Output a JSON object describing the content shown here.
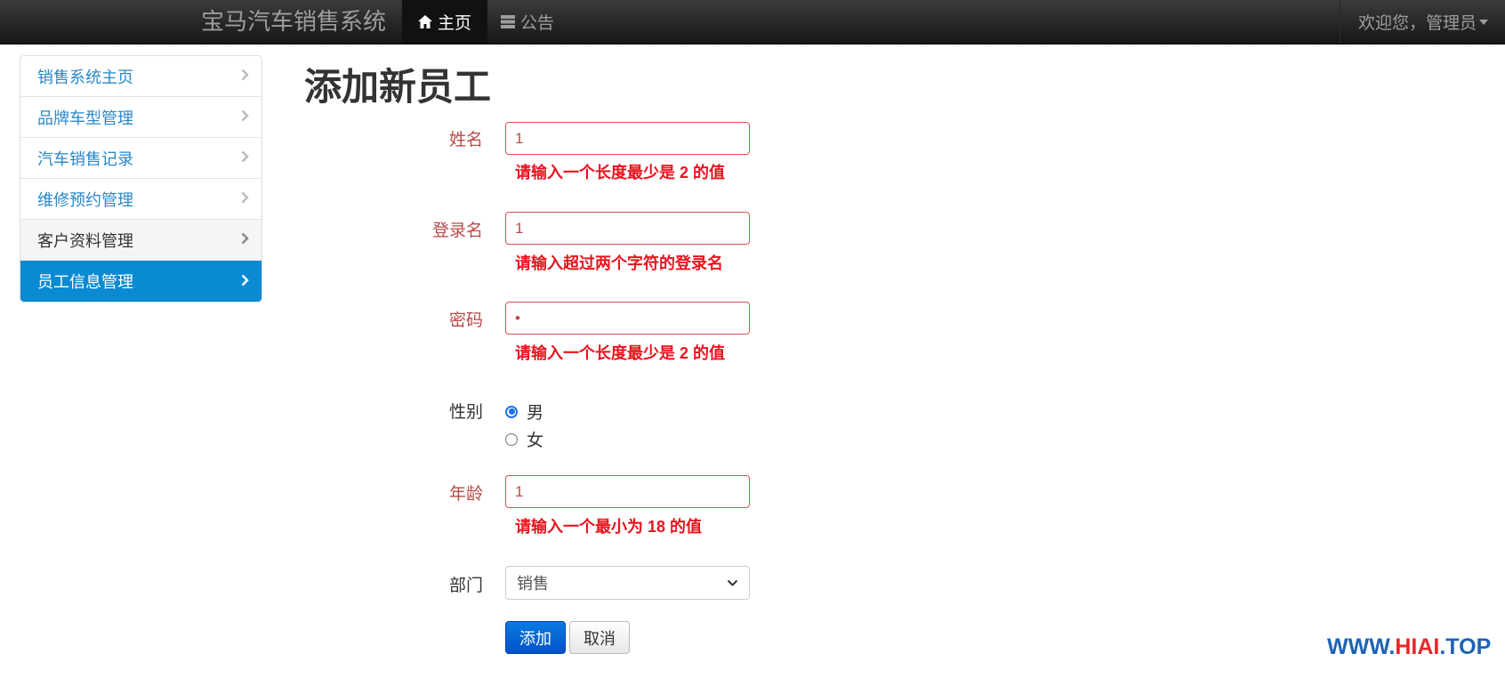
{
  "navbar": {
    "brand": "宝马汽车销售系统",
    "home": "主页",
    "notice": "公告",
    "user": "欢迎您，管理员"
  },
  "sidebar": {
    "items": [
      {
        "label": "销售系统主页"
      },
      {
        "label": "品牌车型管理"
      },
      {
        "label": "汽车销售记录"
      },
      {
        "label": "维修预约管理"
      },
      {
        "label": "客户资料管理"
      },
      {
        "label": "员工信息管理"
      }
    ]
  },
  "page_title": "添加新员工",
  "form": {
    "name": {
      "label": "姓名",
      "value": "1",
      "error": "请输入一个长度最少是 2 的值"
    },
    "login": {
      "label": "登录名",
      "value": "1",
      "error": "请输入超过两个字符的登录名"
    },
    "password": {
      "label": "密码",
      "value": "•",
      "error": "请输入一个长度最少是 2 的值"
    },
    "gender": {
      "label": "性别",
      "options": [
        "男",
        "女"
      ],
      "selected": "男"
    },
    "age": {
      "label": "年龄",
      "value": "1",
      "error": "请输入一个最小为 18 的值"
    },
    "department": {
      "label": "部门",
      "selected": "销售"
    },
    "add_button": "添加",
    "cancel_button": "取消"
  },
  "watermark": {
    "part1": "WWW.",
    "part2": "HIAI",
    "part3": ".TOP"
  },
  "colors": {
    "primary": "#0a8ad2",
    "error": "#b94a48",
    "error_text": "#e9141d"
  }
}
